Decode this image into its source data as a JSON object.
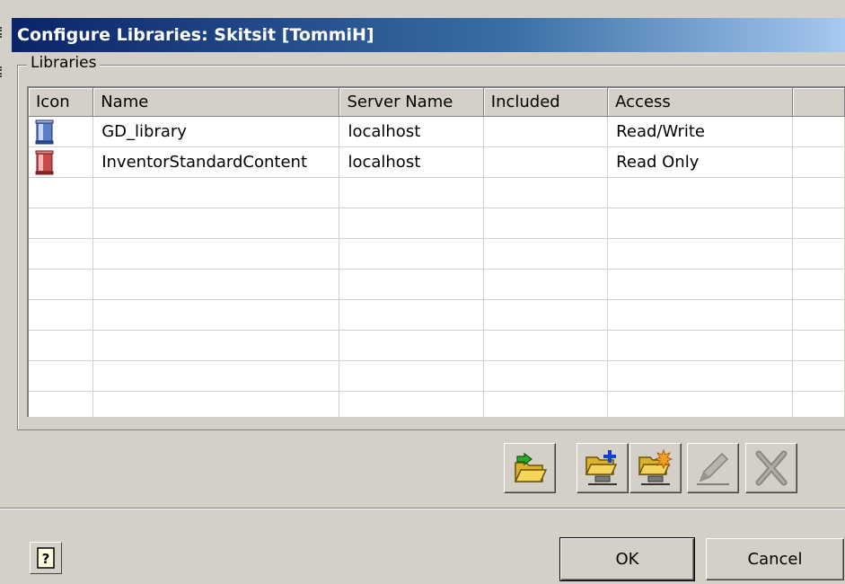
{
  "window": {
    "title": "Configure Libraries: Skitsit [TommiH]"
  },
  "group": {
    "label": "Libraries"
  },
  "table": {
    "columns": [
      "Icon",
      "Name",
      "Server Name",
      "Included",
      "Access"
    ],
    "rows": [
      {
        "icon": "blue-library-icon",
        "name": "GD_library",
        "server": "localhost",
        "included": "",
        "access": "Read/Write"
      },
      {
        "icon": "red-library-icon",
        "name": "InventorStandardContent",
        "server": "localhost",
        "included": "",
        "access": "Read Only"
      }
    ]
  },
  "toolbar": {
    "buttons": [
      "open-folder-icon",
      "add-library-icon",
      "new-library-icon",
      "edit-icon",
      "delete-icon"
    ]
  },
  "footer": {
    "help_label": "?",
    "ok_label": "OK",
    "cancel_label": "Cancel"
  },
  "colors": {
    "title_start": "#0a246a",
    "title_end": "#a6caf0",
    "face": "#d4d0c8"
  }
}
